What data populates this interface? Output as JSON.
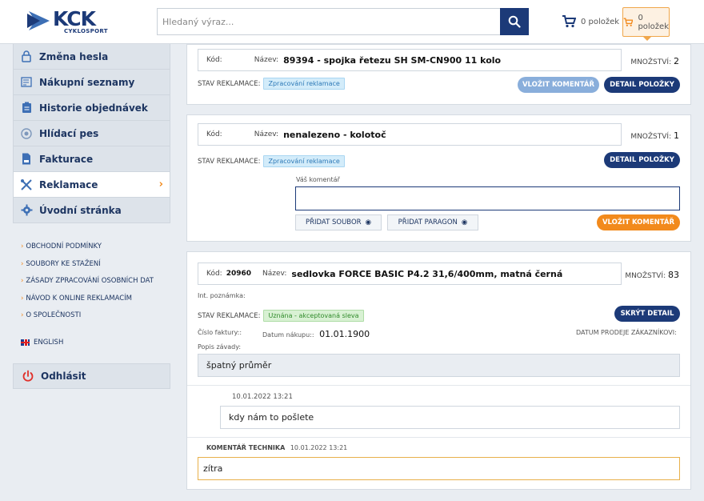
{
  "header": {
    "logo_text": "KCK",
    "logo_sub": "CYKLOSPORT",
    "search_placeholder": "Hledaný výraz...",
    "cart1_label": "0 položek",
    "cart2_label": "0 položek"
  },
  "sidebar": {
    "items": [
      {
        "label": "Změna hesla"
      },
      {
        "label": "Nákupní seznamy"
      },
      {
        "label": "Historie objednávek"
      },
      {
        "label": "Hlídací pes"
      },
      {
        "label": "Fakturace"
      },
      {
        "label": "Reklamace"
      },
      {
        "label": "Úvodní stránka"
      }
    ],
    "links": [
      "OBCHODNÍ PODMÍNKY",
      "SOUBORY KE STAŽENÍ",
      "ZÁSADY ZPRACOVÁNÍ OSOBNÍCH DAT",
      "NÁVOD K ONLINE REKLAMACÍM",
      "O SPOLEČNOSTI"
    ],
    "english": "ENGLISH",
    "logout": "Odhlásit"
  },
  "cards": {
    "c1": {
      "kod_label": "Kód:",
      "nazev_label": "Název:",
      "name": "89394 - spojka řetezu SH SM-CN900 11 kolo",
      "qty_label": "MNOŽSTVÍ:",
      "qty": "2",
      "stav_label": "STAV REKLAMACE:",
      "stav": "Zpracování reklamace",
      "btn_comment": "VLOŽIT KOMENTÁŘ",
      "btn_detail": "DETAIL POLOŽKY"
    },
    "c2": {
      "kod_label": "Kód:",
      "nazev_label": "Název:",
      "name": "nenalezeno - kolotoč",
      "qty_label": "MNOŽSTVÍ:",
      "qty": "1",
      "stav_label": "STAV REKLAMACE:",
      "stav": "Zpracování reklamace",
      "btn_detail": "DETAIL POLOŽKY",
      "comment_label": "Váš komentář",
      "btn_file": "PŘIDAT SOUBOR",
      "btn_receipt": "PŘIDAT PARAGON",
      "btn_comment": "VLOŽIT KOMENTÁŘ"
    },
    "c3": {
      "kod_label": "Kód:",
      "kod": "20960",
      "nazev_label": "Název:",
      "name": "sedlovka FORCE BASIC P4.2 31,6/400mm, matná černá",
      "qty_label": "MNOŽSTVÍ:",
      "qty": "83",
      "int_note": "Int. poznámka:",
      "stav_label": "STAV REKLAMACE:",
      "stav": "Uznána - akceptovaná sleva",
      "btn_hide": "SKRÝT DETAIL",
      "invoice_label": "Číslo faktury::",
      "purchase_label": "Datum nákupu::",
      "purchase_date": "01.01.1900",
      "sale_label": "DATUM PRODEJE ZÁKAZNÍKOVI:",
      "defect_label": "Popis závady:",
      "defect": "špatný průměr",
      "msg1_time": "10.01.2022 13:21",
      "msg1": "kdy nám to pošlete",
      "tech_label": "KOMENTÁŘ TECHNIKA",
      "tech_time": "10.01.2022 13:21",
      "tech_msg": "zítra"
    }
  }
}
